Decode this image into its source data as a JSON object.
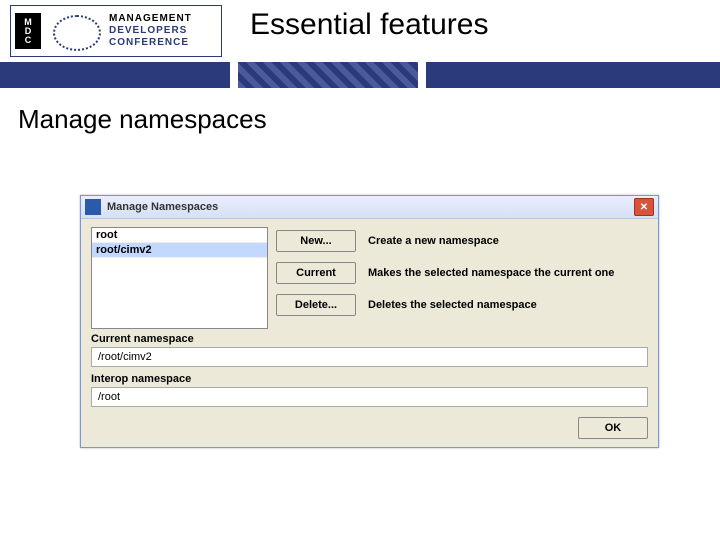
{
  "logo": {
    "line1": "MANAGEMENT",
    "line2": "DEVELOPERS",
    "line3": "CONFERENCE"
  },
  "title": "Essential features",
  "subtitle": "Manage namespaces",
  "dialog": {
    "title": "Manage Namespaces",
    "list": [
      "root",
      "root/cimv2"
    ],
    "actions": [
      {
        "label": "New...",
        "desc": "Create a new namespace"
      },
      {
        "label": "Current",
        "desc": "Makes the selected namespace the current one"
      },
      {
        "label": "Delete...",
        "desc": "Deletes the selected namespace"
      }
    ],
    "current_label": "Current namespace",
    "current_value": "/root/cimv2",
    "interop_label": "Interop namespace",
    "interop_value": "/root",
    "ok": "OK"
  }
}
